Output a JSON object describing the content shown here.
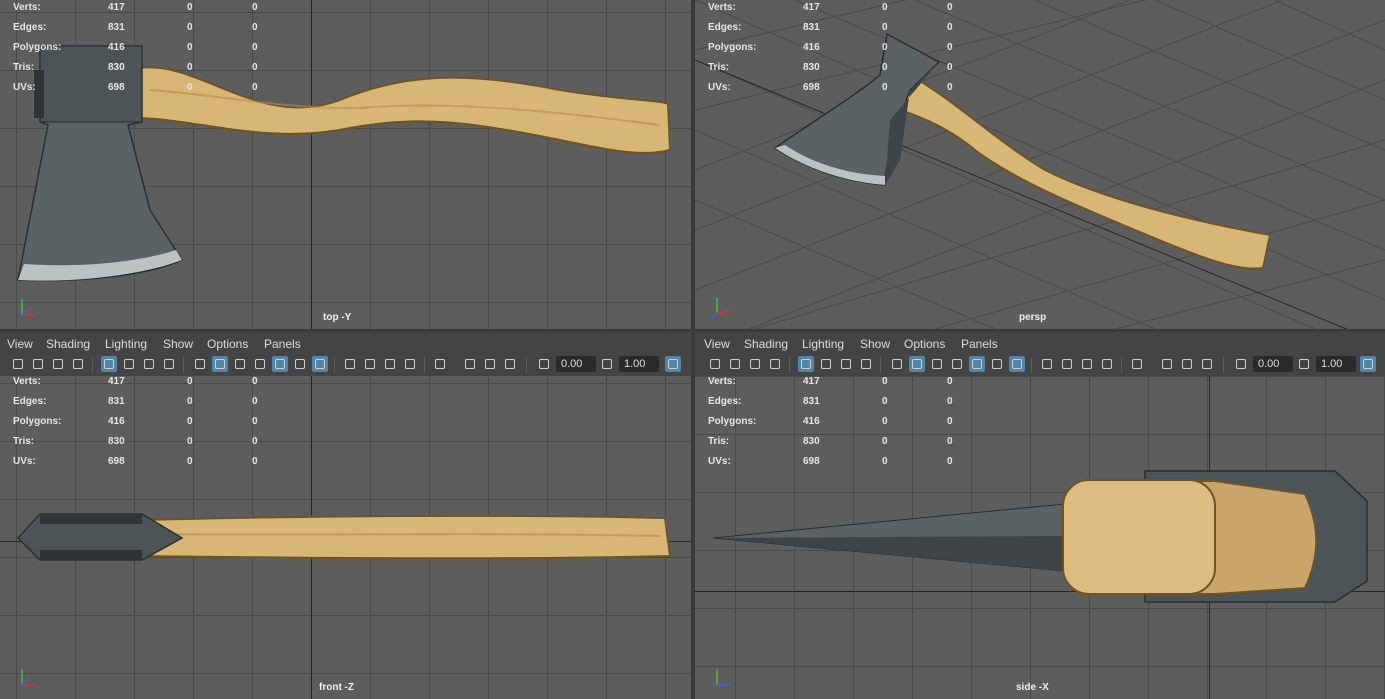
{
  "stats": {
    "labels": [
      "Verts:",
      "Edges:",
      "Polygons:",
      "Tris:",
      "UVs:"
    ],
    "values": [
      [
        "417",
        "0",
        "0"
      ],
      [
        "831",
        "0",
        "0"
      ],
      [
        "416",
        "0",
        "0"
      ],
      [
        "830",
        "0",
        "0"
      ],
      [
        "698",
        "0",
        "0"
      ]
    ]
  },
  "viewports": {
    "top": {
      "camera": "top -Y"
    },
    "persp": {
      "camera": "persp"
    },
    "front": {
      "camera": "front -Z"
    },
    "side": {
      "camera": "side -X"
    }
  },
  "menu": [
    "View",
    "Shading",
    "Lighting",
    "Show",
    "Options",
    "Panels"
  ],
  "toolbar": {
    "exposure": "0.00",
    "gamma": "1.00"
  },
  "gizmo": {
    "x": "x",
    "y": "y",
    "z": "z"
  },
  "colors": {
    "viewport_bg": "#5d5d5d",
    "grid": "#4a4a4a",
    "toolbar_active": "#5285a6",
    "axis_x": "#e03030",
    "axis_y": "#40c040",
    "axis_z": "#4060e0"
  }
}
